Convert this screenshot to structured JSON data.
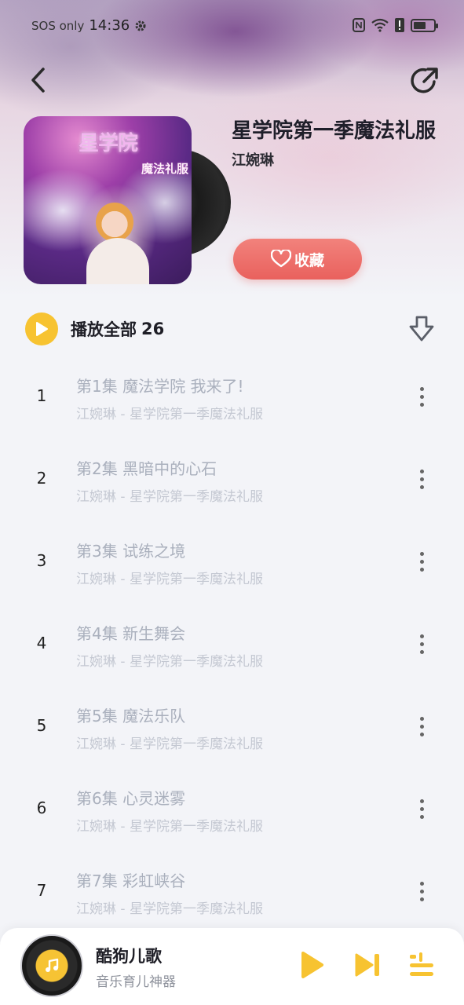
{
  "status_bar": {
    "network_text": "SOS only",
    "time": "14:36",
    "icons": [
      "gear-icon",
      "nfc-icon",
      "wifi-icon",
      "alert-icon",
      "battery-icon"
    ],
    "battery_level": 0.55
  },
  "header": {
    "back_icon": "chevron-left-icon",
    "share_icon": "share-icon"
  },
  "album": {
    "cover_title_text": "星学院",
    "cover_subtitle_text": "魔法礼服",
    "name": "星学院第一季魔法礼服",
    "artist": "江婉琳",
    "favorite_label": "收藏",
    "favorite_icon": "heart-icon"
  },
  "play_all": {
    "label": "播放全部",
    "count": "26",
    "icon": "play-icon",
    "download_icon": "download-icon"
  },
  "tracks": [
    {
      "num": "1",
      "title": "第1集 魔法学院 我来了!",
      "subtitle": "江婉琳 - 星学院第一季魔法礼服"
    },
    {
      "num": "2",
      "title": "第2集 黑暗中的心石",
      "subtitle": "江婉琳 - 星学院第一季魔法礼服"
    },
    {
      "num": "3",
      "title": "第3集 试练之境",
      "subtitle": "江婉琳 - 星学院第一季魔法礼服"
    },
    {
      "num": "4",
      "title": "第4集 新生舞会",
      "subtitle": "江婉琳 - 星学院第一季魔法礼服"
    },
    {
      "num": "5",
      "title": "第5集 魔法乐队",
      "subtitle": "江婉琳 - 星学院第一季魔法礼服"
    },
    {
      "num": "6",
      "title": "第6集 心灵迷雾",
      "subtitle": "江婉琳 - 星学院第一季魔法礼服"
    },
    {
      "num": "7",
      "title": "第7集 彩虹峡谷",
      "subtitle": "江婉琳 - 星学院第一季魔法礼服"
    }
  ],
  "player": {
    "title": "酷狗儿歌",
    "subtitle": "音乐育儿神器",
    "play_icon": "play-icon",
    "next_icon": "next-track-icon",
    "playlist_icon": "playlist-icon"
  },
  "colors": {
    "accent_yellow": "#f7c331",
    "favorite_red": "#e9615d",
    "track_title": "#aab0bd",
    "track_subtitle": "#c4c8d2"
  }
}
